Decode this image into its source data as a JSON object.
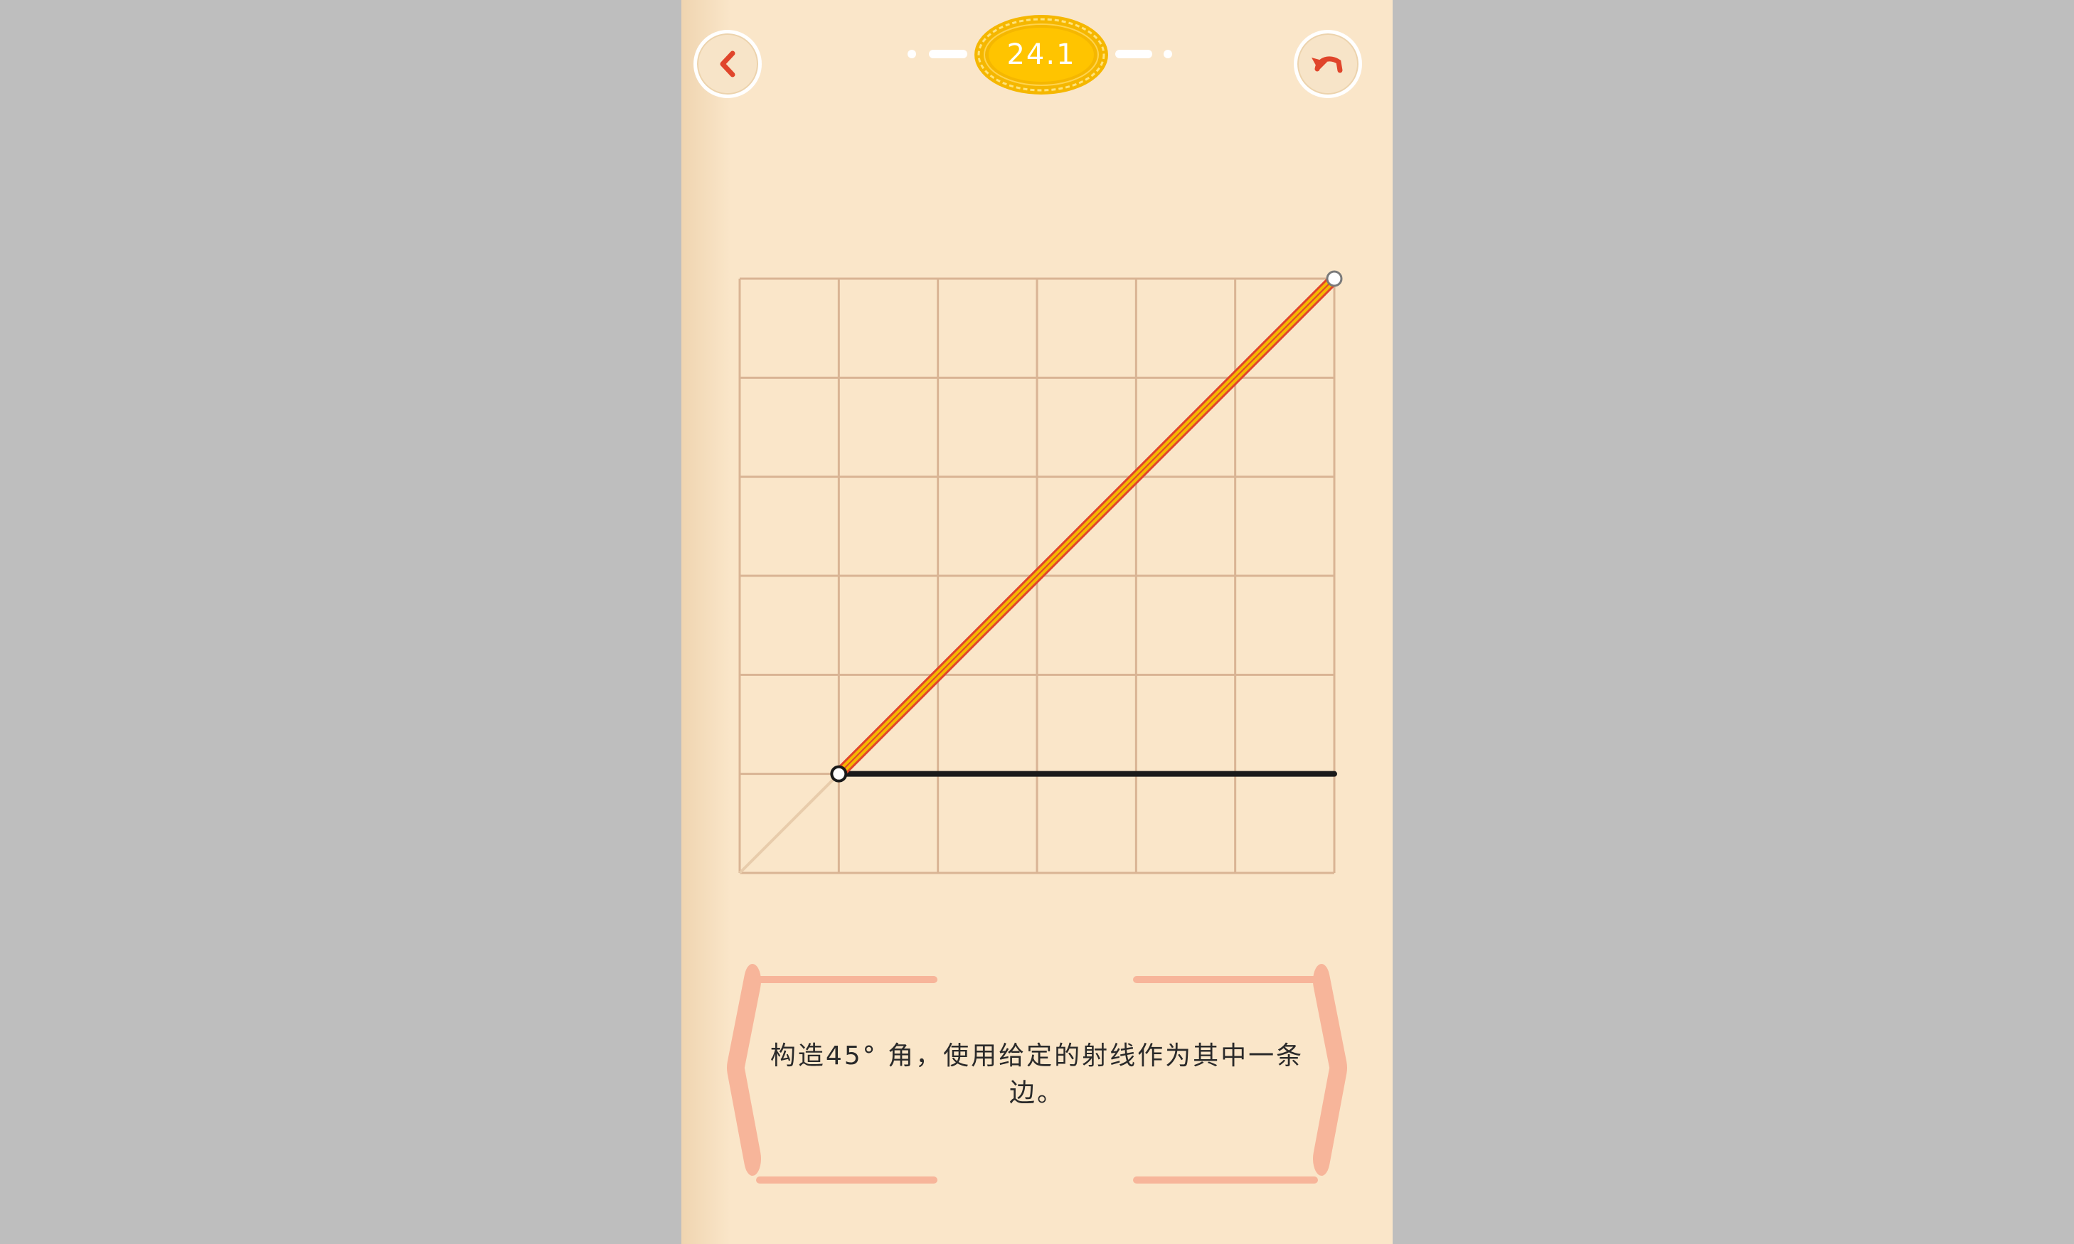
{
  "header": {
    "level_label": "24.1",
    "back_icon": "chevron-left-icon",
    "undo_icon": "undo-arrow-icon"
  },
  "board": {
    "grid_cells": 6,
    "given_ray": {
      "from": [
        1,
        1
      ],
      "to": [
        6,
        1
      ],
      "color": "#1a1a1a"
    },
    "drawn_segment": {
      "from": [
        1,
        1
      ],
      "to": [
        6,
        6
      ],
      "color": "#f5b700"
    },
    "guide_line": {
      "from": [
        0,
        0
      ],
      "to": [
        1,
        1
      ]
    }
  },
  "instruction": {
    "text": "构造45° 角，使用给定的射线作为其中一条边。"
  },
  "colors": {
    "background": "#fae6c9",
    "grid_line": "#d9b494",
    "accent_red": "#e0452b",
    "gold": "#f5b700",
    "bracket": "#f7b59a"
  }
}
